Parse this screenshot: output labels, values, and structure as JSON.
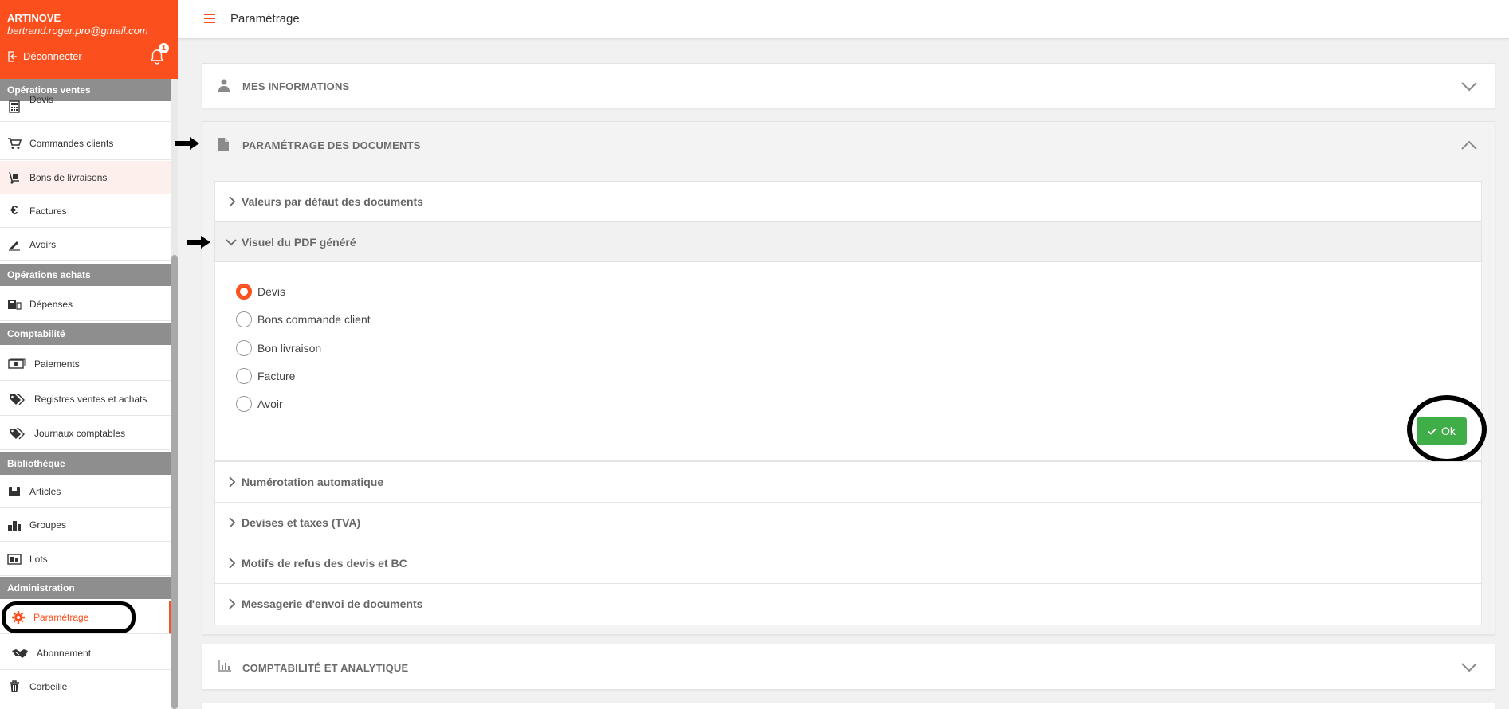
{
  "user": {
    "company": "ARTINOVE",
    "email": "bertrand.roger.pro@gmail.com",
    "logout_label": "Déconnecter",
    "notification_count": "1"
  },
  "topbar": {
    "title": "Paramétrage"
  },
  "sidebar": {
    "sections": [
      {
        "title": "Opérations ventes"
      },
      {
        "title": "Opérations achats"
      },
      {
        "title": "Comptabilité"
      },
      {
        "title": "Bibliothèque"
      },
      {
        "title": "Administration"
      }
    ],
    "items": [
      {
        "label": "Devis",
        "icon": "calculator-icon"
      },
      {
        "label": "Commandes clients",
        "icon": "cart-icon"
      },
      {
        "label": "Bons de livraisons",
        "icon": "hand-truck-icon"
      },
      {
        "label": "Factures",
        "icon": "euro-icon"
      },
      {
        "label": "Avoirs",
        "icon": "signature-icon"
      },
      {
        "label": "Dépenses",
        "icon": "cash-register-icon"
      },
      {
        "label": "Paiements",
        "icon": "money-icon"
      },
      {
        "label": "Registres ventes et achats",
        "icon": "tags-icon"
      },
      {
        "label": "Journaux comptables",
        "icon": "tags-icon"
      },
      {
        "label": "Articles",
        "icon": "box-icon"
      },
      {
        "label": "Groupes",
        "icon": "boxes-icon"
      },
      {
        "label": "Lots",
        "icon": "pallet-icon"
      },
      {
        "label": "Paramétrage",
        "icon": "gear-icon"
      },
      {
        "label": "Abonnement",
        "icon": "handshake-icon"
      },
      {
        "label": "Corbeille",
        "icon": "trash-icon"
      }
    ]
  },
  "panels": {
    "mes_informations": "MES INFORMATIONS",
    "documents": "PARAMÉTRAGE DES DOCUMENTS",
    "comptabilite": "COMPTABILITÉ ET ANALYTIQUE"
  },
  "subsections": {
    "valeurs": "Valeurs par défaut des documents",
    "visuel": "Visuel du PDF généré",
    "numerotation": "Numérotation automatique",
    "devises": "Devises et taxes (TVA)",
    "motifs": "Motifs de refus des devis et BC",
    "messagerie": "Messagerie d'envoi de documents"
  },
  "pdf_options": [
    {
      "label": "Devis",
      "checked": true
    },
    {
      "label": "Bons commande client",
      "checked": false
    },
    {
      "label": "Bon livraison",
      "checked": false
    },
    {
      "label": "Facture",
      "checked": false
    },
    {
      "label": "Avoir",
      "checked": false
    }
  ],
  "ok_label": "Ok",
  "colors": {
    "accent": "#fb4f1e",
    "ok": "#3fae49",
    "section": "#8e8e8e"
  }
}
